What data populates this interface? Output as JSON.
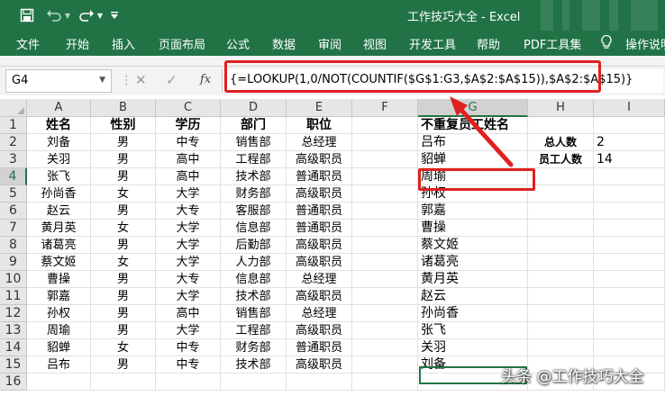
{
  "app": {
    "title": "工作技巧大全  -  Excel",
    "save_icon": "save-icon",
    "undo_icon": "undo-icon",
    "redo_icon": "redo-icon",
    "customize_icon": "customize-qat-icon",
    "colors": {
      "excel_green": "#217346",
      "highlight_red": "#e02020"
    }
  },
  "ribbon": {
    "tabs": [
      "文件",
      "开始",
      "插入",
      "页面布局",
      "公式",
      "数据",
      "审阅",
      "视图",
      "开发工具",
      "帮助",
      "PDF工具集",
      "操作说明"
    ]
  },
  "formula_bar": {
    "name_box": "G4",
    "cancel_glyph": "✕",
    "enter_glyph": "✓",
    "fx_label": "fx",
    "formula": "{=LOOKUP(1,0/NOT(COUNTIF($G$1:G3,$A$2:$A$15)),$A$2:$A$15)}"
  },
  "sheet": {
    "columns": [
      "A",
      "B",
      "C",
      "D",
      "E",
      "F",
      "G",
      "H",
      "I"
    ],
    "row_numbers": [
      "1",
      "2",
      "3",
      "4",
      "5",
      "6",
      "7",
      "8",
      "9",
      "10",
      "11",
      "12",
      "13",
      "14",
      "15",
      "16"
    ],
    "header_row": [
      "姓名",
      "性别",
      "学历",
      "部门",
      "职位",
      "",
      "不重复员工姓名",
      "",
      ""
    ],
    "table_rows": [
      [
        "刘备",
        "男",
        "中专",
        "销售部",
        "总经理"
      ],
      [
        "关羽",
        "男",
        "高中",
        "工程部",
        "高级职员"
      ],
      [
        "张飞",
        "男",
        "高中",
        "技术部",
        "普通职员"
      ],
      [
        "孙尚香",
        "女",
        "大学",
        "财务部",
        "高级职员"
      ],
      [
        "赵云",
        "男",
        "大专",
        "客服部",
        "普通职员"
      ],
      [
        "黄月英",
        "女",
        "大学",
        "信息部",
        "普通职员"
      ],
      [
        "诸葛亮",
        "男",
        "大学",
        "后勤部",
        "高级职员"
      ],
      [
        "蔡文姬",
        "女",
        "大学",
        "人力部",
        "高级职员"
      ],
      [
        "曹操",
        "男",
        "大专",
        "信息部",
        "总经理"
      ],
      [
        "郭嘉",
        "男",
        "大学",
        "技术部",
        "高级职员"
      ],
      [
        "孙权",
        "男",
        "高中",
        "销售部",
        "总经理"
      ],
      [
        "周瑜",
        "男",
        "大学",
        "工程部",
        "高级职员"
      ],
      [
        "貂蝉",
        "女",
        "中专",
        "财务部",
        "普通职员"
      ],
      [
        "吕布",
        "男",
        "中专",
        "技术部",
        "高级职员"
      ]
    ],
    "unique_names": [
      "吕布",
      "貂蝉",
      "周瑜",
      "孙权",
      "郭嘉",
      "曹操",
      "蔡文姬",
      "诸葛亮",
      "黄月英",
      "赵云",
      "孙尚香",
      "张飞",
      "关羽",
      "刘备"
    ],
    "stats": [
      {
        "label": "总人数",
        "value": "2"
      },
      {
        "label": "员工人数",
        "value": "14"
      }
    ]
  },
  "watermark": "头条 @工作技巧大全"
}
